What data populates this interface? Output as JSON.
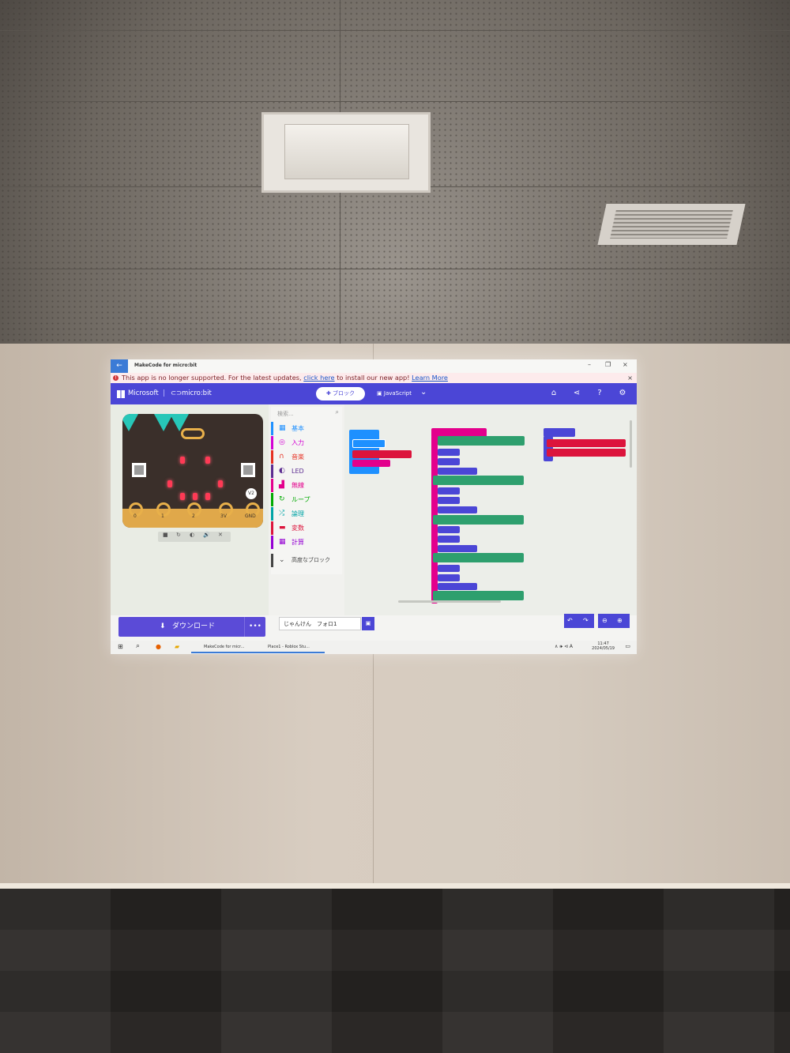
{
  "window": {
    "title": "MakeCode for micro:bit",
    "back_icon": "back-arrow-icon",
    "controls": [
      "–",
      "❐",
      "×"
    ]
  },
  "banner": {
    "text_before": "This app is no longer supported. For the latest updates,",
    "link_click": "click here",
    "text_after": "to install our new app!",
    "link_learn": "Learn More",
    "close": "×"
  },
  "menubar": {
    "brand_microsoft": "Microsoft",
    "brand_microbit": "micro:bit",
    "tab_blocks": "ブロック",
    "tab_js": "JavaScript",
    "dropdown": "⌄",
    "icons": [
      "home-icon",
      "share-icon",
      "help-icon",
      "settings-icon"
    ],
    "accent": "#4b46d6"
  },
  "simulator": {
    "pins": [
      "0",
      "1",
      "2",
      "3V",
      "GND"
    ],
    "badge": "V2",
    "controls": [
      "■",
      "↻",
      "◐",
      "🔊",
      "✕"
    ]
  },
  "toolbox": {
    "search_placeholder": "検索...",
    "categories": [
      {
        "label": "基本",
        "color": "#1e90ff",
        "icon": "▦"
      },
      {
        "label": "入力",
        "color": "#d400d4",
        "icon": "◎"
      },
      {
        "label": "音楽",
        "color": "#e63022",
        "icon": "🎧"
      },
      {
        "label": "LED",
        "color": "#5c2d91",
        "icon": "◐"
      },
      {
        "label": "無線",
        "color": "#e3008c",
        "icon": "📶"
      },
      {
        "label": "ループ",
        "color": "#00aa00",
        "icon": "↻"
      },
      {
        "label": "論理",
        "color": "#00a4a6",
        "icon": "⤮"
      },
      {
        "label": "変数",
        "color": "#dc143c",
        "icon": "▬"
      },
      {
        "label": "計算",
        "color": "#9400d3",
        "icon": "▦"
      }
    ],
    "advanced": "高度なブロック"
  },
  "bottombar": {
    "download": "ダウンロード",
    "download_icon": "download-icon",
    "more": "•••",
    "project_name": "じゃんけん　フォロ1",
    "save_icon": "save-icon",
    "undo": "↶",
    "redo": "↷",
    "zoom_out": "⊖",
    "zoom_in": "⊕"
  },
  "taskbar": {
    "apps": [
      "MakeCode for micr...",
      "Place1 - Roblox Stu..."
    ],
    "time": "11:47",
    "date": "2024/05/19",
    "tray": "∧ 🕪 ⊲ A"
  }
}
